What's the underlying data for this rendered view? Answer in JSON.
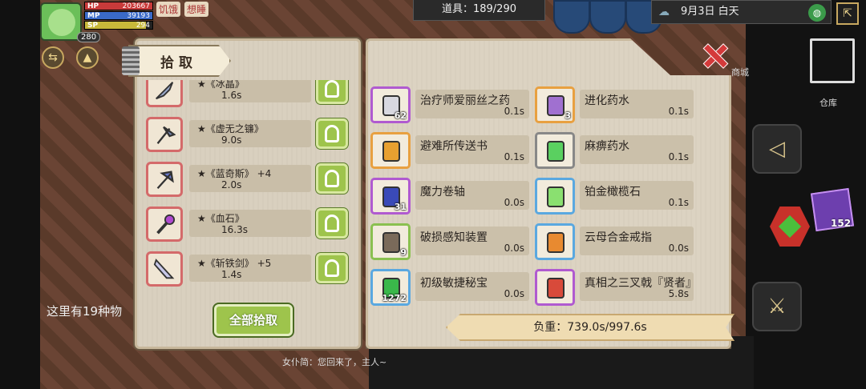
{
  "hud": {
    "level": "280",
    "hp_label": "HP",
    "hp_value": "203667",
    "hp_fill": 1.0,
    "mp_label": "MP",
    "mp_value": "39193",
    "mp_fill": 1.0,
    "sp_label": "SP",
    "sp_value": "294",
    "sp_fill": 0.9,
    "status_hungry": "饥饿",
    "status_sleepy": "想睡"
  },
  "top": {
    "items_counter": "道具：189/290",
    "date": "9月3日  白天"
  },
  "right_side": {
    "shop_label": "商城",
    "warehouse_label": "仓库",
    "quick_item_count": "152"
  },
  "chat": {
    "line": "女仆简：您回来了，主人~",
    "hidden_text": "这里有19种物"
  },
  "pickup_panel": {
    "title": "拾取",
    "pick_all_label": "全部拾取",
    "items": [
      {
        "name": "★《冰晶》",
        "weight": "1.6s",
        "color": "#9aa8c8"
      },
      {
        "name": "★《虚无之镰》",
        "weight": "9.0s",
        "color": "#7a8ab8"
      },
      {
        "name": "★《蓝奇斯》 +4",
        "weight": "2.0s",
        "color": "#6a7ad0"
      },
      {
        "name": "★《血石》",
        "weight": "16.3s",
        "color": "#b04ad0"
      },
      {
        "name": "★《斩铁剑》 +5",
        "weight": "1.4s",
        "color": "#c8c8e8"
      }
    ]
  },
  "bag_panel": {
    "items": [
      {
        "name": "治疗师爱丽丝之药",
        "weight": "0.1s",
        "count": "62",
        "border": "#b05ad0",
        "shape": "#d8d8e0"
      },
      {
        "name": "进化药水",
        "weight": "0.1s",
        "count": "3",
        "border": "#e8a040",
        "shape": "#a070d0"
      },
      {
        "name": "避难所传送书",
        "weight": "0.1s",
        "count": "",
        "border": "#e8a040",
        "shape": "#e8a030"
      },
      {
        "name": "麻痹药水",
        "weight": "0.1s",
        "count": "",
        "border": "#888888",
        "shape": "#5ad060"
      },
      {
        "name": "魔力卷轴",
        "weight": "0.0s",
        "count": "31",
        "border": "#b05ad0",
        "shape": "#3a4ab8"
      },
      {
        "name": "铂金橄榄石",
        "weight": "0.1s",
        "count": "",
        "border": "#5aa8e0",
        "shape": "#8ae070"
      },
      {
        "name": "破损感知装置",
        "weight": "0.0s",
        "count": "9",
        "border": "#8ac050",
        "shape": "#7a6a5a"
      },
      {
        "name": "云母合金戒指",
        "weight": "0.0s",
        "count": "",
        "border": "#5aa8e0",
        "shape": "#e88a30"
      },
      {
        "name": "初级敏捷秘宝",
        "weight": "0.0s",
        "count": "1272",
        "border": "#5aa8e0",
        "shape": "#3ab84a"
      },
      {
        "name": "真相之三叉戟『贤者』",
        "weight": "5.8s",
        "count": "",
        "border": "#b05ad0",
        "shape": "#d84a3a"
      }
    ],
    "load_label": "负重：739.0s/997.6s"
  }
}
